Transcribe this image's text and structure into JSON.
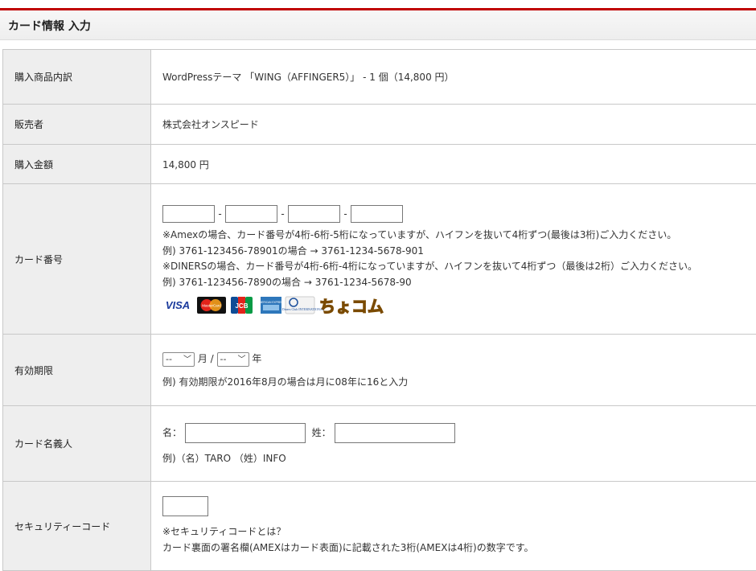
{
  "header": {
    "title": "カード情報 入力"
  },
  "rows": {
    "item": {
      "label": "購入商品内訳",
      "value": "WordPressテーマ 「WING（AFFINGER5）」 - 1 個（14,800 円）"
    },
    "seller": {
      "label": "販売者",
      "value": "株式会社オンスピード"
    },
    "amount": {
      "label": "購入金額",
      "value": "14,800 円"
    },
    "card": {
      "label": "カード番号",
      "dash": "-",
      "note1": "※Amexの場合、カード番号が4桁-6桁-5桁になっていますが、ハイフンを抜いて4桁ずつ(最後は3桁)ご入力ください。",
      "note2": "例) 3761-123456-78901の場合 → 3761-1234-5678-901",
      "note3": "※DINERSの場合、カード番号が4桁-6桁-4桁になっていますが、ハイフンを抜いて4桁ずつ（最後は2桁）ご入力ください。",
      "note4": "例) 3761-123456-7890の場合 → 3761-1234-5678-90",
      "brands": {
        "visa": "VISA",
        "mastercard": "MasterCard",
        "jcb": "JCB",
        "amex": "AMERICAN EXPRESS",
        "diners": "Diners Club INTERNATIONAL",
        "chocom": "ちょコム"
      }
    },
    "expiry": {
      "label": "有効期限",
      "month_value": "--",
      "month_unit": "月",
      "slash": "/",
      "year_value": "--",
      "year_unit": "年",
      "example": "例) 有効期限が2016年8月の場合は月に08年に16と入力"
    },
    "holder": {
      "label": "カード名義人",
      "first_label": "名：",
      "last_label": "姓：",
      "example": "例)（名）TARO （姓）INFO"
    },
    "security": {
      "label": "セキュリティーコード",
      "note1": "※セキュリティコードとは？",
      "note2": "カード裏面の署名欄(AMEXはカード表面)に記載された3桁(AMEXは4桁)の数字です。"
    }
  }
}
